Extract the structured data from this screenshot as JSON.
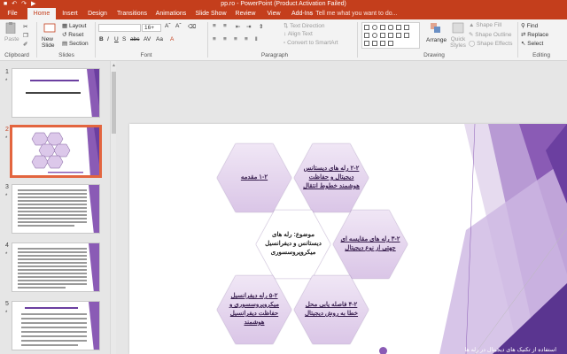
{
  "window": {
    "title": "pp.ro - PowerPoint (Product Activation Failed)"
  },
  "qat": {
    "save_icon": "save-icon",
    "undo_icon": "undo-icon",
    "redo_icon": "redo-icon",
    "present_icon": "present-icon"
  },
  "tabs": [
    "File",
    "Home",
    "Insert",
    "Design",
    "Transitions",
    "Animations",
    "Slide Show",
    "Review",
    "View",
    "Add-Ins"
  ],
  "active_tab": "Home",
  "tell_me": "Tell me what you want to do...",
  "ribbon": {
    "clipboard": {
      "label": "Clipboard",
      "paste": "Paste"
    },
    "slides": {
      "label": "Slides",
      "new_slide": "New Slide",
      "layout": "Layout",
      "reset": "Reset",
      "section": "Section"
    },
    "font": {
      "label": "Font",
      "size": "16+"
    },
    "paragraph": {
      "label": "Paragraph",
      "text_direction": "Text Direction",
      "align_text": "Align Text",
      "convert": "Convert to SmartArt"
    },
    "drawing": {
      "label": "Drawing",
      "arrange": "Arrange",
      "quick_styles": "Quick Styles",
      "shape_fill": "Shape Fill",
      "shape_outline": "Shape Outline",
      "shape_effects": "Shape Effects"
    },
    "editing": {
      "label": "Editing",
      "find": "Find",
      "replace": "Replace",
      "select": "Select"
    }
  },
  "thumbnails": [
    {
      "number": "1",
      "star": "*"
    },
    {
      "number": "2",
      "star": "*"
    },
    {
      "number": "3",
      "star": "*"
    },
    {
      "number": "4",
      "star": "*"
    },
    {
      "number": "5",
      "star": "*"
    }
  ],
  "slide": {
    "hexagons": [
      {
        "id": "intro",
        "text": "۱-۲ مقدمه"
      },
      {
        "id": "digital-links",
        "text": "۲-۲ رله های دیستانس دیجیتال و حفاظت هوشمند خطوط انتقال"
      },
      {
        "id": "topic",
        "text": "موضوع: رله های دیستانس و دیفرانسیل میکروپروسسوری"
      },
      {
        "id": "compare",
        "text": "۳-۲ رله های مقایسه ای جهتی از نوع دیجیتال"
      },
      {
        "id": "differential",
        "text": "۵-۲ رله دیفرانسیل میکروپروسسوری و حفاظت دیفرانسیل هوشمند"
      },
      {
        "id": "fault-distance",
        "text": "۴-۲ فاصله یابی محل خطا به روش دیجیتال"
      }
    ],
    "footer": "استفاده از تکنیک های دیجیتال در رله ها"
  },
  "colors": {
    "accent": "#c43e1c",
    "hex_fill": "#e8dcf0",
    "hex_stroke": "#7b5a9a",
    "purple": "#8a5bb5"
  }
}
